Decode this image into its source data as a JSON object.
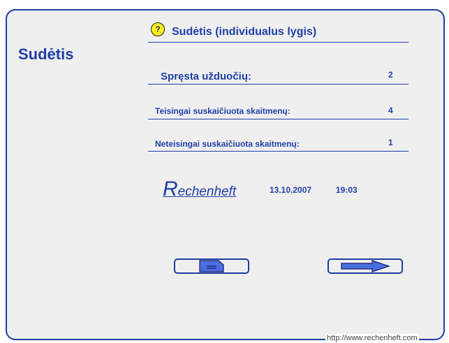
{
  "page": {
    "title": "Sudėtis",
    "header_title": "Sudėtis (individualus lygis)",
    "help_symbol": "?"
  },
  "stats": [
    {
      "label": "Spręsta užduočių:",
      "value": "2"
    },
    {
      "label": "Teisingai suskaičiuota skaitmenų:",
      "value": "4"
    },
    {
      "label": "Neteisingai suskaičiuota skaitmenų:",
      "value": "1"
    }
  ],
  "brand": {
    "initial": "R",
    "rest": "echenheft"
  },
  "date": "13.10.2007",
  "time": "19:03",
  "buttons": {
    "notes_icon": "document-icon",
    "next_icon": "arrow-right-icon"
  },
  "footer_url": "http://www.rechenheft.com",
  "colors": {
    "accent": "#1f3fa8",
    "frame_bg": "#efefef",
    "help_bg": "#ffee22"
  }
}
